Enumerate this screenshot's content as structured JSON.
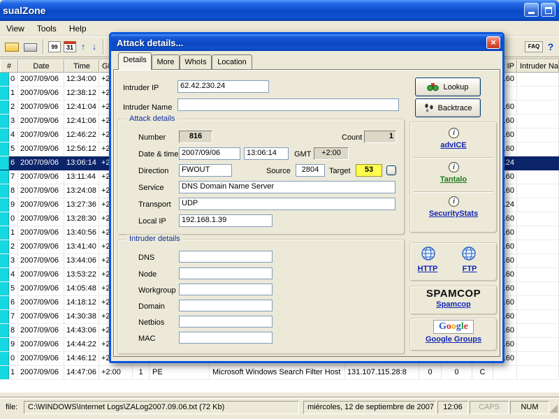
{
  "window": {
    "title": "sualZone",
    "menu": [
      "View",
      "Tools",
      "Help"
    ],
    "toolbar_left": [
      {
        "name": "open-log-icon"
      },
      {
        "name": "print-icon"
      },
      {
        "name": "separator"
      },
      {
        "name": "numbered-list-icon",
        "text": "99"
      },
      {
        "name": "calendar-icon",
        "text": "31"
      },
      {
        "name": "sort-up-icon",
        "text": "↑"
      },
      {
        "name": "sort-down-icon",
        "text": "↓"
      },
      {
        "name": "separator"
      }
    ],
    "toolbar_right": [
      {
        "name": "faq-icon",
        "text": "FAQ"
      },
      {
        "name": "help-icon",
        "text": "?"
      },
      {
        "name": "zonealarma-icon"
      }
    ]
  },
  "table": {
    "headers": [
      "#",
      "Date",
      "Time",
      "GMT",
      "",
      "",
      "",
      "",
      "",
      "",
      "",
      "Intruder IP",
      "Intruder Name"
    ],
    "rows": [
      {
        "n": "0",
        "date": "2007/09/06",
        "time": "12:34:00",
        "gmt": "+2:00",
        "ip": "1.60"
      },
      {
        "n": "1",
        "date": "2007/09/06",
        "time": "12:38:12",
        "gmt": "+2:00",
        "ip": ""
      },
      {
        "n": "2",
        "date": "2007/09/06",
        "time": "12:41:04",
        "gmt": "+2:00",
        "ip": "1.60"
      },
      {
        "n": "3",
        "date": "2007/09/06",
        "time": "12:41:06",
        "gmt": "+2:00",
        "ip": "1.60"
      },
      {
        "n": "4",
        "date": "2007/09/06",
        "time": "12:46:22",
        "gmt": "+2:00",
        "ip": "1.60"
      },
      {
        "n": "5",
        "date": "2007/09/06",
        "time": "12:56:12",
        "gmt": "+2:00",
        "ip": "1.60"
      },
      {
        "n": "6",
        "date": "2007/09/06",
        "time": "13:06:14",
        "gmt": "+2:00",
        "ip": "0.24",
        "selected": true
      },
      {
        "n": "7",
        "date": "2007/09/06",
        "time": "13:11:44",
        "gmt": "+2:00",
        "ip": "1.60"
      },
      {
        "n": "8",
        "date": "2007/09/06",
        "time": "13:24:08",
        "gmt": "+2:00",
        "ip": "1.60"
      },
      {
        "n": "9",
        "date": "2007/09/06",
        "time": "13:27:36",
        "gmt": "+2:00",
        "ip": "0.24"
      },
      {
        "n": "0",
        "date": "2007/09/06",
        "time": "13:28:30",
        "gmt": "+2:00",
        "ip": "1.60"
      },
      {
        "n": "1",
        "date": "2007/09/06",
        "time": "13:40:56",
        "gmt": "+2:00",
        "ip": "1.60"
      },
      {
        "n": "2",
        "date": "2007/09/06",
        "time": "13:41:40",
        "gmt": "+2:00",
        "ip": "1.60"
      },
      {
        "n": "3",
        "date": "2007/09/06",
        "time": "13:44:06",
        "gmt": "+2:00",
        "ip": "1.60"
      },
      {
        "n": "4",
        "date": "2007/09/06",
        "time": "13:53:22",
        "gmt": "+2:00",
        "ip": "1.60"
      },
      {
        "n": "5",
        "date": "2007/09/06",
        "time": "14:05:48",
        "gmt": "+2:00",
        "ip": "1.60"
      },
      {
        "n": "6",
        "date": "2007/09/06",
        "time": "14:18:12",
        "gmt": "+2:00",
        "ip": "1.60"
      },
      {
        "n": "7",
        "date": "2007/09/06",
        "time": "14:30:38",
        "gmt": "+2:00",
        "ip": "1.60"
      },
      {
        "n": "8",
        "date": "2007/09/06",
        "time": "14:43:06",
        "gmt": "+2:00",
        "ip": "1.60"
      },
      {
        "n": "9",
        "date": "2007/09/06",
        "time": "14:44:22",
        "gmt": "+2:00",
        "ip": "1.60"
      },
      {
        "n": "0",
        "date": "2007/09/06",
        "time": "14:46:12",
        "gmt": "+2:00",
        "ip": "1.60"
      },
      {
        "n": "1",
        "date": "2007/09/06",
        "time": "14:47:06",
        "gmt": "+2:00",
        "count": "1",
        "type": "PE",
        "service": "Microsoft Windows Search Filter Host",
        "remote": "131.107.115.28:8",
        "a": "0",
        "b": "0",
        "flag": "C"
      }
    ]
  },
  "dialog": {
    "title": "Attack details...",
    "close_glyph": "×",
    "tabs": [
      "Details",
      "More",
      "WhoIs",
      "Location"
    ],
    "active_tab": "Details",
    "icons": {
      "info": "i"
    },
    "labels": {
      "intruder_ip": "Intruder IP",
      "intruder_name": "Intruder Name",
      "attack_details": "Attack details",
      "number": "Number",
      "count": "Count",
      "date_time": "Date & time",
      "gmt": "GMT",
      "direction": "Direction",
      "source": "Source",
      "target": "Target",
      "service": "Service",
      "transport": "Transport",
      "local_ip": "Local IP",
      "intruder_details": "Intruder details",
      "dns": "DNS",
      "node": "Node",
      "workgroup": "Workgroup",
      "domain": "Domain",
      "netbios": "Netbios",
      "mac": "MAC"
    },
    "values": {
      "intruder_ip": "62.42.230.24",
      "intruder_name": "",
      "number": "816",
      "count": "1",
      "date": "2007/09/06",
      "time": "13:06:14",
      "gmt": "+2:00",
      "direction": "FWOUT",
      "source": "2804",
      "target": "53",
      "service": "DNS Domain Name Server",
      "transport": "UDP",
      "local_ip": "192.168.1.39",
      "dns": "",
      "node": "",
      "workgroup": "",
      "domain": "",
      "netbios": "",
      "mac": ""
    },
    "buttons": {
      "lookup": "Lookup",
      "backtrace": "Backtrace"
    },
    "links": {
      "advice": "advICE",
      "tantalo": "Tantalo",
      "securitystats": "SecurityStats",
      "http": "HTTP",
      "ftp": "FTP",
      "spamcop": "Spamcop",
      "google_groups": "Google Groups"
    },
    "logos": {
      "spamcop": "SPAMCOP",
      "google": [
        {
          "ch": "G",
          "c": "#2a56c6"
        },
        {
          "ch": "o",
          "c": "#d93025"
        },
        {
          "ch": "o",
          "c": "#f2a713"
        },
        {
          "ch": "g",
          "c": "#2a56c6"
        },
        {
          "ch": "l",
          "c": "#1e9e3e"
        },
        {
          "ch": "e",
          "c": "#d93025"
        }
      ]
    }
  },
  "statusbar": {
    "file_label": "file:",
    "file_path": "C:\\WINDOWS\\Internet Logs\\ZALog2007.09.06.txt  (72 Kb)",
    "date": "miércoles, 12 de septiembre de 2007",
    "time": "12:06",
    "caps": "CAPS",
    "num": "NUM"
  }
}
